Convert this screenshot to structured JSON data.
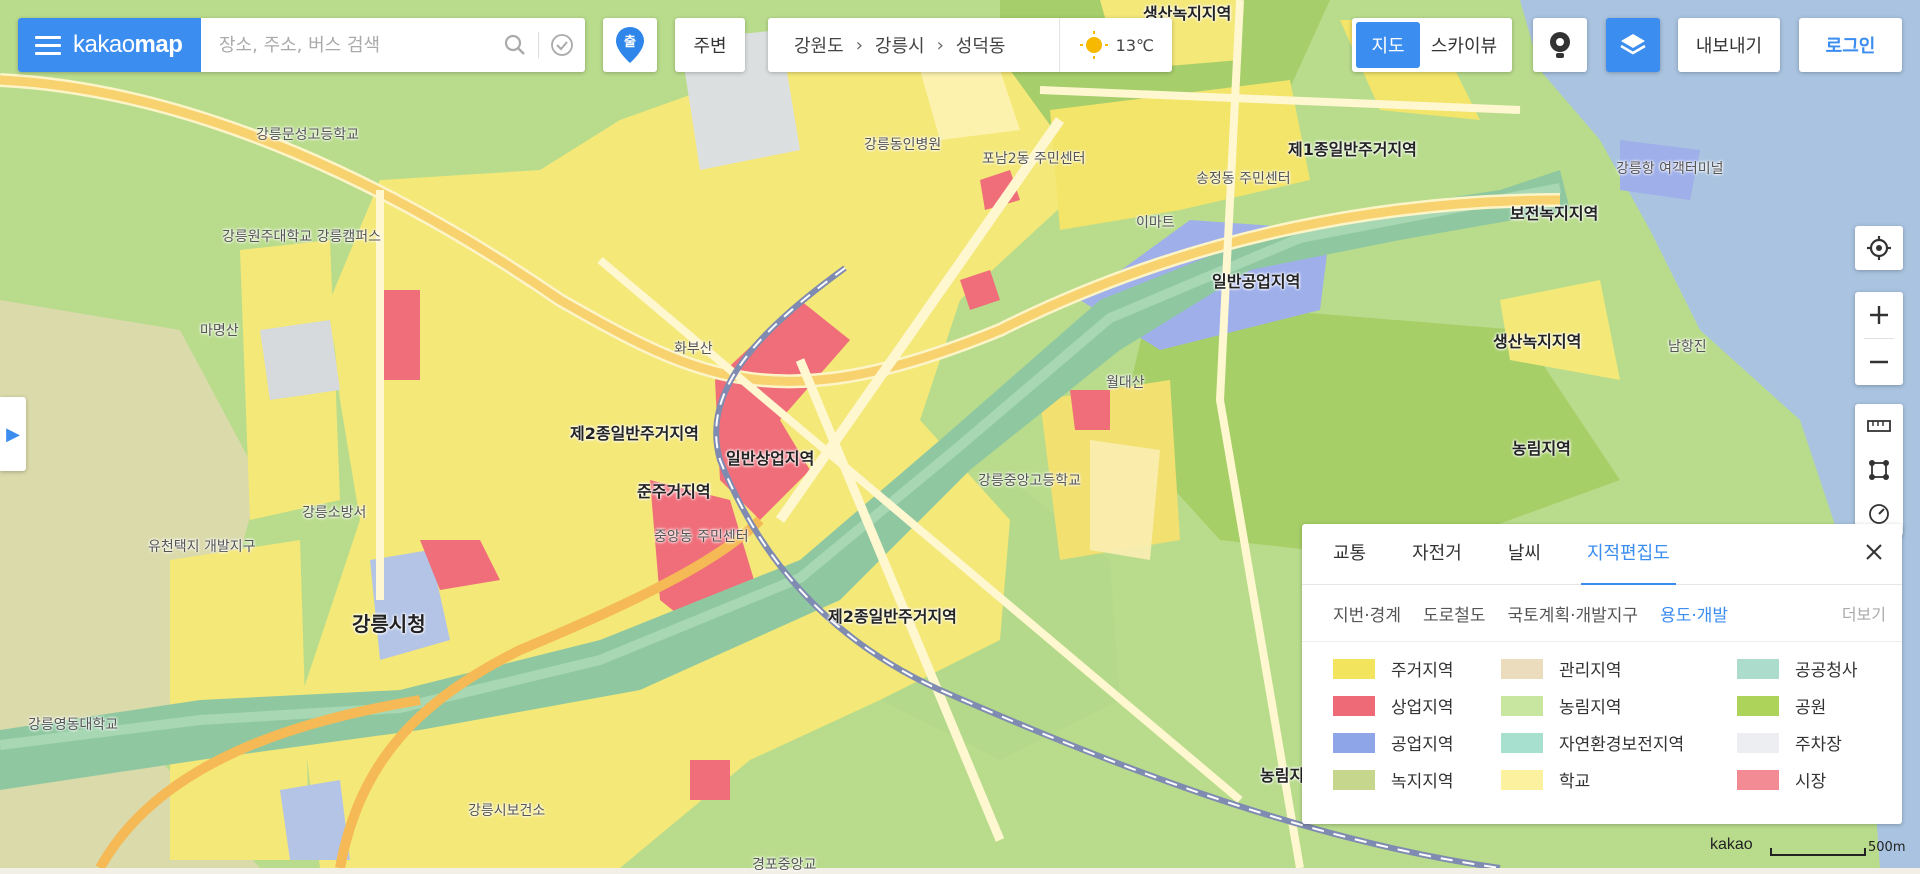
{
  "app": {
    "logo_light": "kakao",
    "logo_bold": "map"
  },
  "search": {
    "placeholder": "장소, 주소, 버스 검색"
  },
  "toolbar": {
    "start_marker_label": "출",
    "nearby": "주변",
    "breadcrumb": [
      "강원도",
      "강릉시",
      "성덕동"
    ],
    "weather_temp": "13℃",
    "map_view": "지도",
    "sky_view": "스카이뷰",
    "export": "내보내기",
    "login": "로그인"
  },
  "legend": {
    "tabs": [
      "교통",
      "자전거",
      "날씨",
      "지적편집도"
    ],
    "active_tab": "지적편집도",
    "subtabs": [
      "지번·경계",
      "도로철도",
      "국토계획·개발지구",
      "용도·개발"
    ],
    "active_subtab": "용도·개발",
    "more": "더보기",
    "items": [
      {
        "label": "주거지역",
        "color": "#f2e45d"
      },
      {
        "label": "관리지역",
        "color": "#ecdcbe"
      },
      {
        "label": "공공청사",
        "color": "#acdccc"
      },
      {
        "label": "상업지역",
        "color": "#ee6a76"
      },
      {
        "label": "농림지역",
        "color": "#c8e6a0"
      },
      {
        "label": "공원",
        "color": "#aed35a"
      },
      {
        "label": "공업지역",
        "color": "#8ea6e8"
      },
      {
        "label": "자연환경보전지역",
        "color": "#a8e0d0"
      },
      {
        "label": "주차장",
        "color": "#eceef2"
      },
      {
        "label": "녹지지역",
        "color": "#c6d68c"
      },
      {
        "label": "학교",
        "color": "#fcf19e"
      },
      {
        "label": "시장",
        "color": "#f28b94"
      }
    ]
  },
  "scale": {
    "brand": "kakao",
    "distance": "500m"
  },
  "map_labels": [
    {
      "text": "생산녹지지역",
      "cls": "bold"
    },
    {
      "text": "제1종일반주거지역",
      "cls": "bold"
    },
    {
      "text": "보전녹지지역",
      "cls": "bold"
    },
    {
      "text": "일반공업지역",
      "cls": "bold"
    },
    {
      "text": "생산녹지지역",
      "cls": "bold"
    },
    {
      "text": "농림지역",
      "cls": "bold"
    },
    {
      "text": "제2종일반주거지역",
      "cls": "bold"
    },
    {
      "text": "일반상업지역",
      "cls": "bold"
    },
    {
      "text": "준주거지역",
      "cls": "bold"
    },
    {
      "text": "제2종일반주거지역",
      "cls": "bold"
    },
    {
      "text": "농림지",
      "cls": "bold"
    },
    {
      "text": "강릉시청",
      "cls": "district"
    },
    {
      "text": "강릉문성고등학교",
      "cls": "small"
    },
    {
      "text": "강릉원주대학교 강릉캠퍼스",
      "cls": "small"
    },
    {
      "text": "마명산",
      "cls": "small"
    },
    {
      "text": "강릉항 여객터미널",
      "cls": "small"
    },
    {
      "text": "강릉동인병원",
      "cls": "small"
    },
    {
      "text": "포남2동 주민센터",
      "cls": "small"
    },
    {
      "text": "이마트",
      "cls": "small"
    },
    {
      "text": "화부산",
      "cls": "small"
    },
    {
      "text": "강릉중앙고등학교",
      "cls": "small"
    },
    {
      "text": "월대산",
      "cls": "small"
    },
    {
      "text": "강릉소방서",
      "cls": "small"
    },
    {
      "text": "유천택지 개발지구",
      "cls": "small"
    },
    {
      "text": "강릉영동대학교",
      "cls": "small"
    },
    {
      "text": "강릉시보건소",
      "cls": "small"
    },
    {
      "text": "경포중앙교",
      "cls": "small"
    },
    {
      "text": "송정동 주민센터",
      "cls": "small"
    },
    {
      "text": "남항진",
      "cls": "small"
    },
    {
      "text": "중앙동 주민센터",
      "cls": "small"
    }
  ]
}
